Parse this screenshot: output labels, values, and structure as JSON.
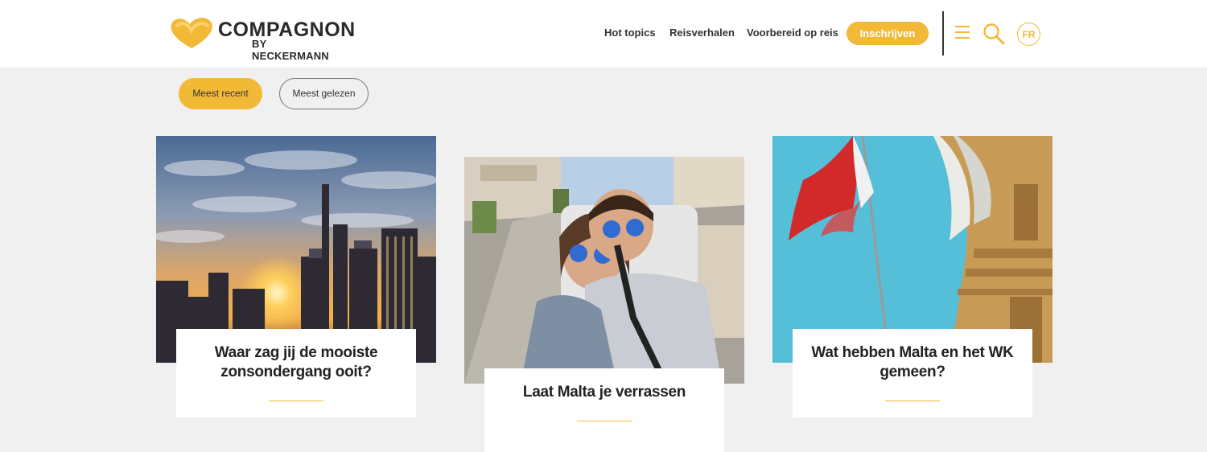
{
  "brand": {
    "name": "COMPAGNON",
    "subname": "BY NECKERMANN",
    "colors": {
      "accent": "#f2b937",
      "text": "#2b2b2b",
      "background": "#f0f0f0"
    }
  },
  "nav": {
    "links": [
      "Hot topics",
      "Reisverhalen",
      "Voorbereid op reis"
    ],
    "cta": "Inschrijven",
    "language": "FR",
    "icons": [
      "menu-icon",
      "search-icon"
    ]
  },
  "filters": {
    "items": [
      "Meest recent",
      "Meest gelezen"
    ],
    "active": "Meest recent"
  },
  "cards": [
    {
      "title": "Waar zag jij de mooiste zonsondergang ooit?",
      "image": "city-sunset-skyline"
    },
    {
      "title": "Laat Malta je verrassen",
      "image": "couple-selfie-street"
    },
    {
      "title": "Wat hebben Malta en het WK gemeen?",
      "image": "maltese-flag-building"
    }
  ]
}
